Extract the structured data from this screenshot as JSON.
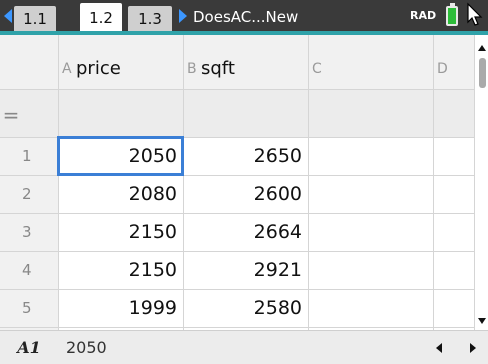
{
  "tabs": [
    "1.1",
    "1.2",
    "1.3"
  ],
  "active_tab_index": 1,
  "document_title": "DoesAC...New",
  "angle_mode": "RAD",
  "columns": [
    {
      "letter": "A",
      "name": "price"
    },
    {
      "letter": "B",
      "name": "sqft"
    },
    {
      "letter": "C",
      "name": ""
    },
    {
      "letter": "D",
      "name": ""
    }
  ],
  "formula_row_symbol": "=",
  "rows": [
    {
      "num": "1",
      "A": "2050",
      "B": "2650"
    },
    {
      "num": "2",
      "A": "2080",
      "B": "2600"
    },
    {
      "num": "3",
      "A": "2150",
      "B": "2664"
    },
    {
      "num": "4",
      "A": "2150",
      "B": "2921"
    },
    {
      "num": "5",
      "A": "1999",
      "B": "2580"
    }
  ],
  "status": {
    "cell_ref": "A1",
    "cell_value": "2050"
  },
  "colors": {
    "accent": "#2fa2a9",
    "selection": "#3b7fd6",
    "tab_arrow": "#3c97ff",
    "battery": "#2dbd3a"
  }
}
